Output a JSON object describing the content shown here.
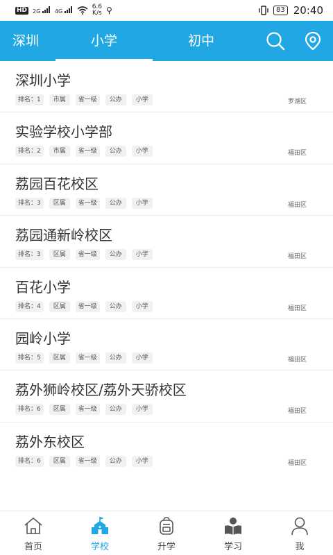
{
  "status": {
    "hd": "HD",
    "network_1": "2G",
    "network_2": "4G",
    "speed_value": "6.6",
    "speed_unit": "K/s",
    "battery": "83",
    "time": "20:40"
  },
  "topbar": {
    "city": "深圳",
    "tabs": [
      {
        "label": "小学",
        "active": true
      },
      {
        "label": "初中",
        "active": false
      }
    ],
    "accent_color": "#21a8e4"
  },
  "schools": [
    {
      "name": "深圳小学",
      "rank": "排名：1",
      "level": "市属",
      "grade": "省一级",
      "type": "公办",
      "stage": "小学",
      "district": "罗湖区"
    },
    {
      "name": "实验学校小学部",
      "rank": "排名：2",
      "level": "市属",
      "grade": "省一级",
      "type": "公办",
      "stage": "小学",
      "district": "福田区"
    },
    {
      "name": "荔园百花校区",
      "rank": "排名：3",
      "level": "区属",
      "grade": "省一级",
      "type": "公办",
      "stage": "小学",
      "district": "福田区"
    },
    {
      "name": "荔园通新岭校区",
      "rank": "排名：3",
      "level": "区属",
      "grade": "省一级",
      "type": "公办",
      "stage": "小学",
      "district": "福田区"
    },
    {
      "name": "百花小学",
      "rank": "排名：4",
      "level": "区属",
      "grade": "省一级",
      "type": "公办",
      "stage": "小学",
      "district": "福田区"
    },
    {
      "name": "园岭小学",
      "rank": "排名：5",
      "level": "区属",
      "grade": "省一级",
      "type": "公办",
      "stage": "小学",
      "district": "福田区"
    },
    {
      "name": "荔外狮岭校区/荔外天骄校区",
      "rank": "排名：6",
      "level": "区属",
      "grade": "省一级",
      "type": "公办",
      "stage": "小学",
      "district": "福田区"
    },
    {
      "name": "荔外东校区",
      "rank": "排名：6",
      "level": "区属",
      "grade": "省一级",
      "type": "公办",
      "stage": "小学",
      "district": "福田区"
    }
  ],
  "bottom_nav": {
    "items": [
      {
        "label": "首页",
        "icon": "home-icon",
        "active": false
      },
      {
        "label": "学校",
        "icon": "school-icon",
        "active": true
      },
      {
        "label": "升学",
        "icon": "backpack-icon",
        "active": false
      },
      {
        "label": "学习",
        "icon": "reading-icon",
        "active": false
      },
      {
        "label": "我",
        "icon": "profile-icon",
        "active": false
      }
    ]
  }
}
